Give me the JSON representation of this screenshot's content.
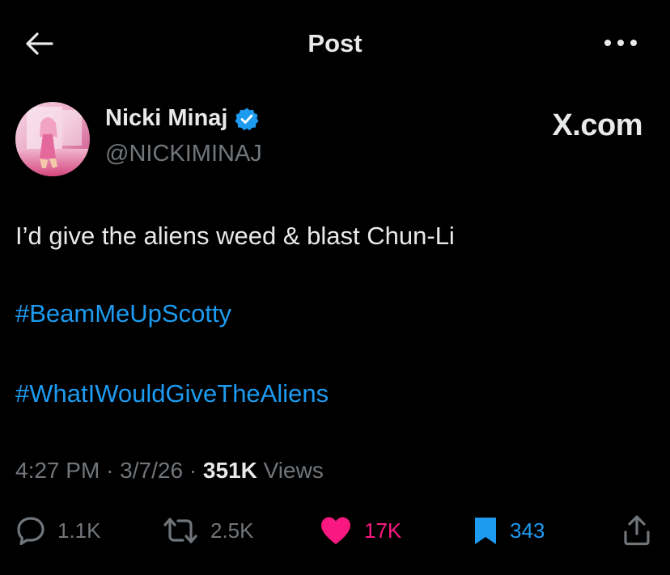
{
  "header": {
    "title": "Post",
    "back_icon": "arrow-left-icon",
    "more_icon": "more-horizontal-icon"
  },
  "author": {
    "name": "Nicki Minaj",
    "handle": "@NICKIMINAJ",
    "verified": true,
    "verified_icon": "verified-badge-icon"
  },
  "brand": {
    "label": "X.com"
  },
  "post": {
    "text": "I’d give the aliens weed & blast Chun-Li",
    "hashtags": [
      "#BeamMeUpScotty",
      "#WhatIWouldGiveTheAliens"
    ]
  },
  "meta": {
    "time": "4:27 PM",
    "date": "3/7/26",
    "separator": "·",
    "views_count": "351K",
    "views_label": "Views"
  },
  "actions": {
    "reply": {
      "icon": "reply-icon",
      "count": "1.1K"
    },
    "repost": {
      "icon": "repost-icon",
      "count": "2.5K"
    },
    "like": {
      "icon": "heart-icon",
      "count": "17K",
      "active": true
    },
    "bookmark": {
      "icon": "bookmark-icon",
      "count": "343",
      "active": true
    },
    "share": {
      "icon": "share-icon"
    }
  },
  "colors": {
    "background": "#000000",
    "text": "#e7e9ea",
    "secondary": "#71767b",
    "link": "#1d9bf0",
    "like": "#f91880"
  }
}
